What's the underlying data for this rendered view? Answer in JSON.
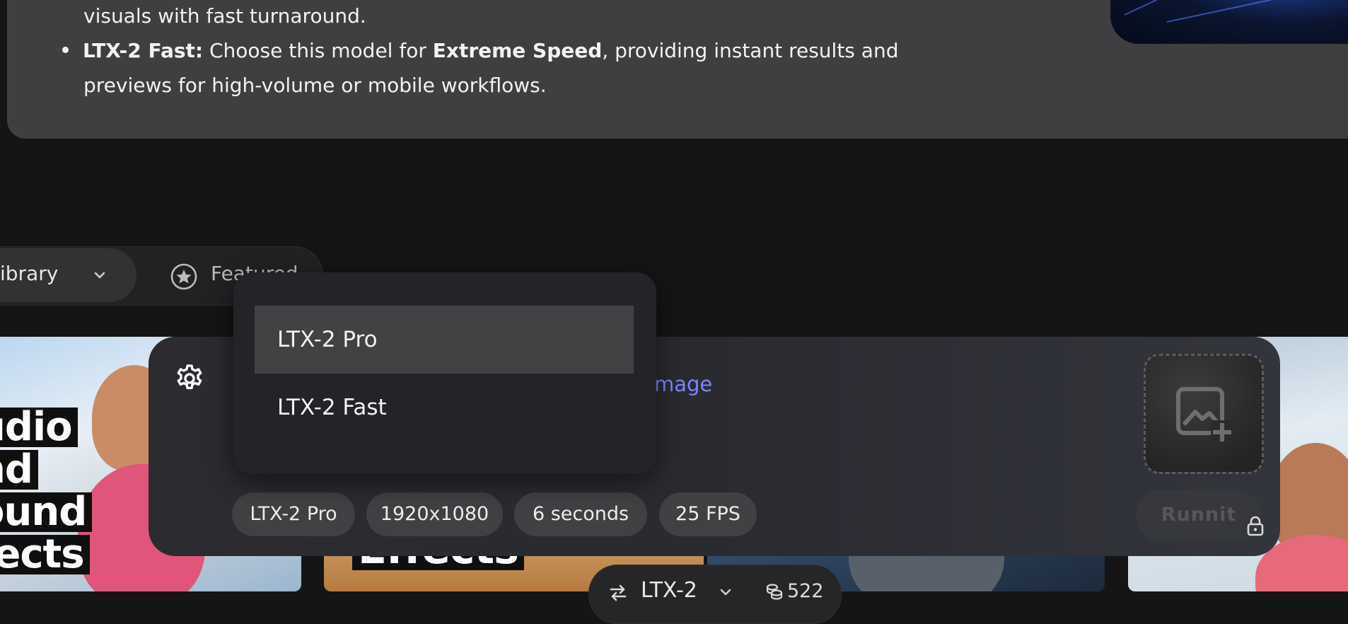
{
  "description": {
    "line_a": "visuals with fast turnaround.",
    "bullet_title": "LTX-2 Fast:",
    "bullet_pre": " Choose this model for ",
    "bullet_strong": "Extreme Speed",
    "bullet_post": ", providing instant results and",
    "line_c": "previews for high-volume or mobile workflows."
  },
  "tabs": {
    "library_label": "ibrary",
    "featured_label": "Featured"
  },
  "gallery": {
    "thumb1_lines": [
      "udio",
      "nd",
      "ound",
      "fects"
    ],
    "thumb2_text": "Effects"
  },
  "composer": {
    "link_text": "mage",
    "chips": [
      "LTX-2 Pro",
      "1920x1080",
      "6 seconds",
      "25 FPS"
    ],
    "run_label": "Runnit"
  },
  "model_dropdown": {
    "options": [
      "LTX-2 Pro",
      "LTX-2 Fast"
    ],
    "selected": "LTX-2 Pro"
  },
  "bottom_bar": {
    "model": "LTX-2",
    "credits": "522"
  },
  "colors": {
    "accent_link": "#7a86ff",
    "background": "#151515"
  }
}
